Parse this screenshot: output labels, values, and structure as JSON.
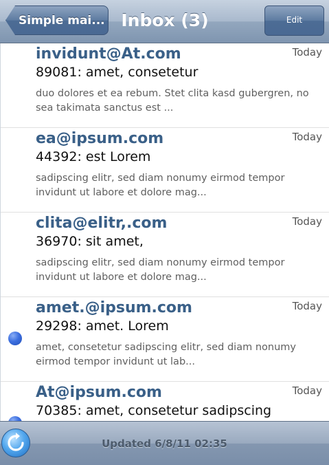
{
  "navbar": {
    "back_label": "Simple mai...",
    "title": "Inbox (3)",
    "edit_label": "Edit"
  },
  "messages": [
    {
      "sender": "invidunt@At.com",
      "date": "Today",
      "subject": "89081: amet, consetetur",
      "preview": "duo dolores et ea rebum. Stet clita kasd gubergren, no sea takimata sanctus est ...",
      "unread": false
    },
    {
      "sender": "ea@ipsum.com",
      "date": "Today",
      "subject": "44392: est Lorem",
      "preview": "sadipscing elitr, sed diam nonumy eirmod tempor invidunt ut labore et dolore mag...",
      "unread": false
    },
    {
      "sender": "clita@elitr,.com",
      "date": "Today",
      "subject": "36970: sit amet,",
      "preview": "sadipscing elitr, sed diam nonumy eirmod tempor invidunt ut labore et dolore mag...",
      "unread": false
    },
    {
      "sender": "amet.@ipsum.com",
      "date": "Today",
      "subject": "29298: amet. Lorem",
      "preview": "amet, consetetur sadipscing elitr, sed diam nonumy eirmod tempor invidunt ut lab...",
      "unread": true
    },
    {
      "sender": "At@ipsum.com",
      "date": "Today",
      "subject": "70385: amet, consetetur sadipscing",
      "preview": "",
      "unread": true
    }
  ],
  "toolbar": {
    "updated_text": "Updated 6/8/11  02:35",
    "refresh_icon": "refresh-icon"
  },
  "colors": {
    "sender": "#3a6088",
    "unread_dot": "#3c6fe0",
    "navbar": "#a9b9cd"
  }
}
